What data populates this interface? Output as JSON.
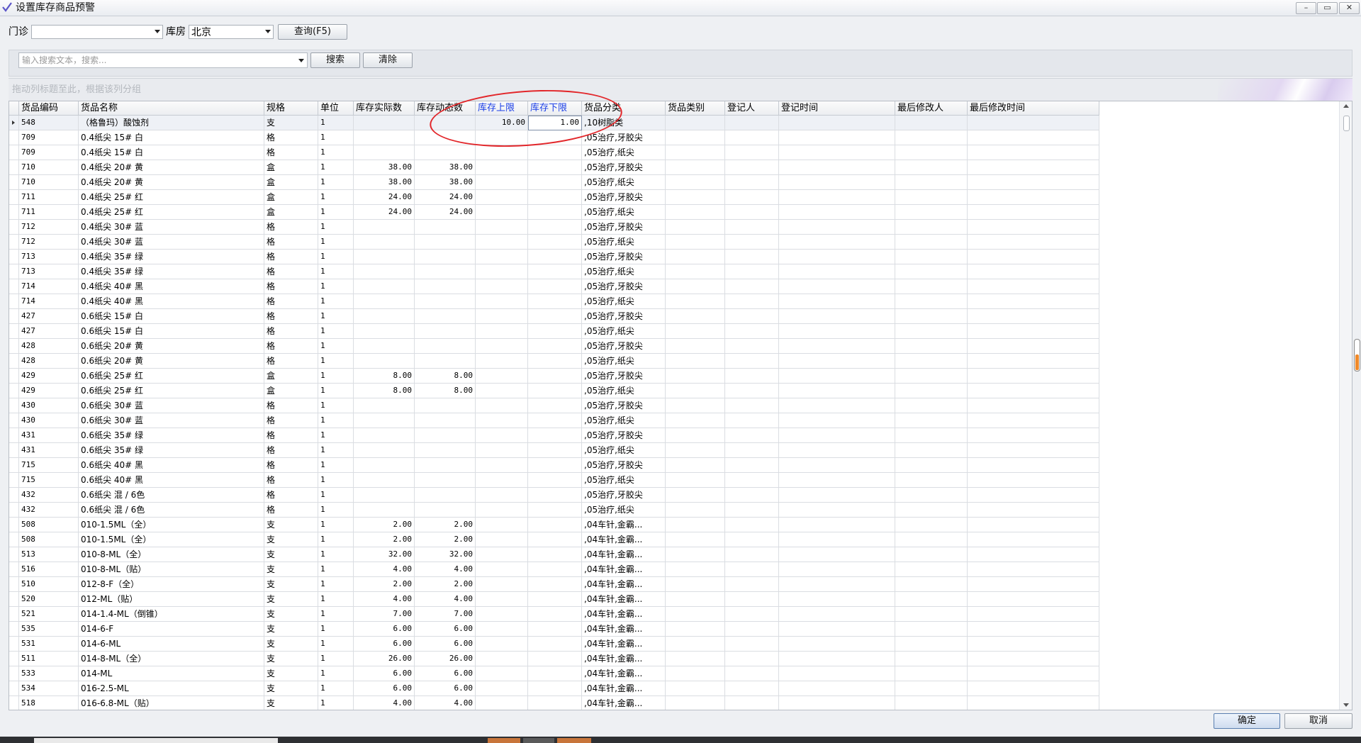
{
  "window": {
    "title": "设置库存商品预警",
    "controls": [
      "–",
      "▭",
      "✕"
    ]
  },
  "filters": {
    "clinic_label": "门诊",
    "clinic_value": "",
    "warehouse_label": "库房",
    "warehouse_value": "北京",
    "query_button": "查询(F5)"
  },
  "search": {
    "placeholder": "输入搜索文本，搜索...",
    "search_button": "搜索",
    "clear_button": "清除"
  },
  "group_hint": "拖动列标题至此，根据该列分组",
  "columns": [
    "货品编码",
    "货品名称",
    "规格",
    "单位",
    "库存实际数",
    "库存动态数",
    "库存上限",
    "库存下限",
    "货品分类",
    "货品类别",
    "登记人",
    "登记时间",
    "最后修改人",
    "最后修改时间"
  ],
  "highlight_color": "#1a3ee6",
  "annotation_color": "#e2262a",
  "rows": [
    [
      "548",
      "（格鲁玛）酸蚀剂",
      "支",
      "1",
      "",
      "",
      "10.00",
      "1.00",
      ",10树脂类"
    ],
    [
      "709",
      "0.4纸尖 15# 白",
      "格",
      "1",
      "",
      "",
      "",
      "",
      ",05治疗,牙胶尖"
    ],
    [
      "709",
      "0.4纸尖 15# 白",
      "格",
      "1",
      "",
      "",
      "",
      "",
      ",05治疗,纸尖"
    ],
    [
      "710",
      "0.4纸尖 20# 黄",
      "盒",
      "1",
      "38.00",
      "38.00",
      "",
      "",
      ",05治疗,牙胶尖"
    ],
    [
      "710",
      "0.4纸尖 20# 黄",
      "盒",
      "1",
      "38.00",
      "38.00",
      "",
      "",
      ",05治疗,纸尖"
    ],
    [
      "711",
      "0.4纸尖 25# 红",
      "盒",
      "1",
      "24.00",
      "24.00",
      "",
      "",
      ",05治疗,牙胶尖"
    ],
    [
      "711",
      "0.4纸尖 25# 红",
      "盒",
      "1",
      "24.00",
      "24.00",
      "",
      "",
      ",05治疗,纸尖"
    ],
    [
      "712",
      "0.4纸尖 30# 蓝",
      "格",
      "1",
      "",
      "",
      "",
      "",
      ",05治疗,牙胶尖"
    ],
    [
      "712",
      "0.4纸尖 30# 蓝",
      "格",
      "1",
      "",
      "",
      "",
      "",
      ",05治疗,纸尖"
    ],
    [
      "713",
      "0.4纸尖 35# 绿",
      "格",
      "1",
      "",
      "",
      "",
      "",
      ",05治疗,牙胶尖"
    ],
    [
      "713",
      "0.4纸尖 35# 绿",
      "格",
      "1",
      "",
      "",
      "",
      "",
      ",05治疗,纸尖"
    ],
    [
      "714",
      "0.4纸尖 40# 黑",
      "格",
      "1",
      "",
      "",
      "",
      "",
      ",05治疗,牙胶尖"
    ],
    [
      "714",
      "0.4纸尖 40# 黑",
      "格",
      "1",
      "",
      "",
      "",
      "",
      ",05治疗,纸尖"
    ],
    [
      "427",
      "0.6纸尖 15# 白",
      "格",
      "1",
      "",
      "",
      "",
      "",
      ",05治疗,牙胶尖"
    ],
    [
      "427",
      "0.6纸尖 15# 白",
      "格",
      "1",
      "",
      "",
      "",
      "",
      ",05治疗,纸尖"
    ],
    [
      "428",
      "0.6纸尖 20# 黄",
      "格",
      "1",
      "",
      "",
      "",
      "",
      ",05治疗,牙胶尖"
    ],
    [
      "428",
      "0.6纸尖 20# 黄",
      "格",
      "1",
      "",
      "",
      "",
      "",
      ",05治疗,纸尖"
    ],
    [
      "429",
      "0.6纸尖 25# 红",
      "盒",
      "1",
      "8.00",
      "8.00",
      "",
      "",
      ",05治疗,牙胶尖"
    ],
    [
      "429",
      "0.6纸尖 25# 红",
      "盒",
      "1",
      "8.00",
      "8.00",
      "",
      "",
      ",05治疗,纸尖"
    ],
    [
      "430",
      "0.6纸尖 30# 蓝",
      "格",
      "1",
      "",
      "",
      "",
      "",
      ",05治疗,牙胶尖"
    ],
    [
      "430",
      "0.6纸尖 30# 蓝",
      "格",
      "1",
      "",
      "",
      "",
      "",
      ",05治疗,纸尖"
    ],
    [
      "431",
      "0.6纸尖 35# 绿",
      "格",
      "1",
      "",
      "",
      "",
      "",
      ",05治疗,牙胶尖"
    ],
    [
      "431",
      "0.6纸尖 35# 绿",
      "格",
      "1",
      "",
      "",
      "",
      "",
      ",05治疗,纸尖"
    ],
    [
      "715",
      "0.6纸尖 40# 黑",
      "格",
      "1",
      "",
      "",
      "",
      "",
      ",05治疗,牙胶尖"
    ],
    [
      "715",
      "0.6纸尖 40# 黑",
      "格",
      "1",
      "",
      "",
      "",
      "",
      ",05治疗,纸尖"
    ],
    [
      "432",
      "0.6纸尖 混 / 6色",
      "格",
      "1",
      "",
      "",
      "",
      "",
      ",05治疗,牙胶尖"
    ],
    [
      "432",
      "0.6纸尖 混 / 6色",
      "格",
      "1",
      "",
      "",
      "",
      "",
      ",05治疗,纸尖"
    ],
    [
      "508",
      "010-1.5ML（全）",
      "支",
      "1",
      "2.00",
      "2.00",
      "",
      "",
      ",04车针,金霸..."
    ],
    [
      "508",
      "010-1.5ML（全）",
      "支",
      "1",
      "2.00",
      "2.00",
      "",
      "",
      ",04车针,金霸..."
    ],
    [
      "513",
      "010-8-ML（全）",
      "支",
      "1",
      "32.00",
      "32.00",
      "",
      "",
      ",04车针,金霸..."
    ],
    [
      "516",
      "010-8-ML（贴）",
      "支",
      "1",
      "4.00",
      "4.00",
      "",
      "",
      ",04车针,金霸..."
    ],
    [
      "510",
      "012-8-F（全）",
      "支",
      "1",
      "2.00",
      "2.00",
      "",
      "",
      ",04车针,金霸..."
    ],
    [
      "520",
      "012-ML（贴）",
      "支",
      "1",
      "4.00",
      "4.00",
      "",
      "",
      ",04车针,金霸..."
    ],
    [
      "521",
      "014-1.4-ML（倒锥）",
      "支",
      "1",
      "7.00",
      "7.00",
      "",
      "",
      ",04车针,金霸..."
    ],
    [
      "535",
      "014-6-F",
      "支",
      "1",
      "6.00",
      "6.00",
      "",
      "",
      ",04车针,金霸..."
    ],
    [
      "531",
      "014-6-ML",
      "支",
      "1",
      "6.00",
      "6.00",
      "",
      "",
      ",04车针,金霸..."
    ],
    [
      "511",
      "014-8-ML（全）",
      "支",
      "1",
      "26.00",
      "26.00",
      "",
      "",
      ",04车针,金霸..."
    ],
    [
      "533",
      "014-ML",
      "支",
      "1",
      "6.00",
      "6.00",
      "",
      "",
      ",04车针,金霸..."
    ],
    [
      "534",
      "016-2.5-ML",
      "支",
      "1",
      "6.00",
      "6.00",
      "",
      "",
      ",04车针,金霸..."
    ],
    [
      "518",
      "016-6.8-ML（贴）",
      "支",
      "1",
      "4.00",
      "4.00",
      "",
      "",
      ",04车针,金霸..."
    ]
  ],
  "footer": {
    "ok_button": "确定",
    "cancel_button": "取消"
  }
}
